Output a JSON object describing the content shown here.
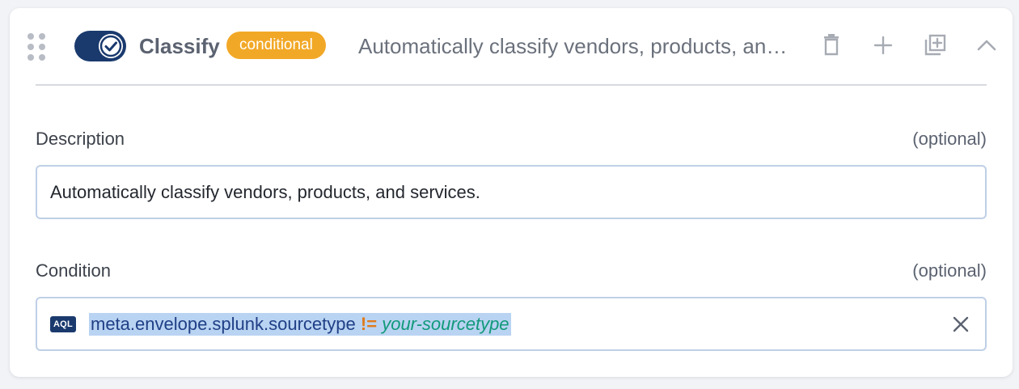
{
  "step": {
    "title": "Classify",
    "badge": "conditional",
    "summary": "Automatically classify vendors, products, and services.",
    "enabled": true
  },
  "description": {
    "label": "Description",
    "optional": "(optional)",
    "value": "Automatically classify vendors, products, and services."
  },
  "condition": {
    "label": "Condition",
    "optional": "(optional)",
    "lang_badge": "AQL",
    "query": {
      "field": "meta.envelope.splunk.sourcetype",
      "operator": "!=",
      "value": "your-sourcetype"
    }
  },
  "icons": {
    "drag": "drag-handle-icon",
    "toggle": "check-icon",
    "delete": "trash-icon",
    "add": "plus-icon",
    "duplicate": "duplicate-icon",
    "collapse": "chevron-up-icon",
    "clear": "close-icon"
  },
  "colors": {
    "toggle": "#1a3a6e",
    "badge": "#f2a827",
    "query_field": "#1f3f86",
    "query_operator": "#e07b1a",
    "query_value": "#11997a",
    "selection": "#b9d3f2"
  }
}
